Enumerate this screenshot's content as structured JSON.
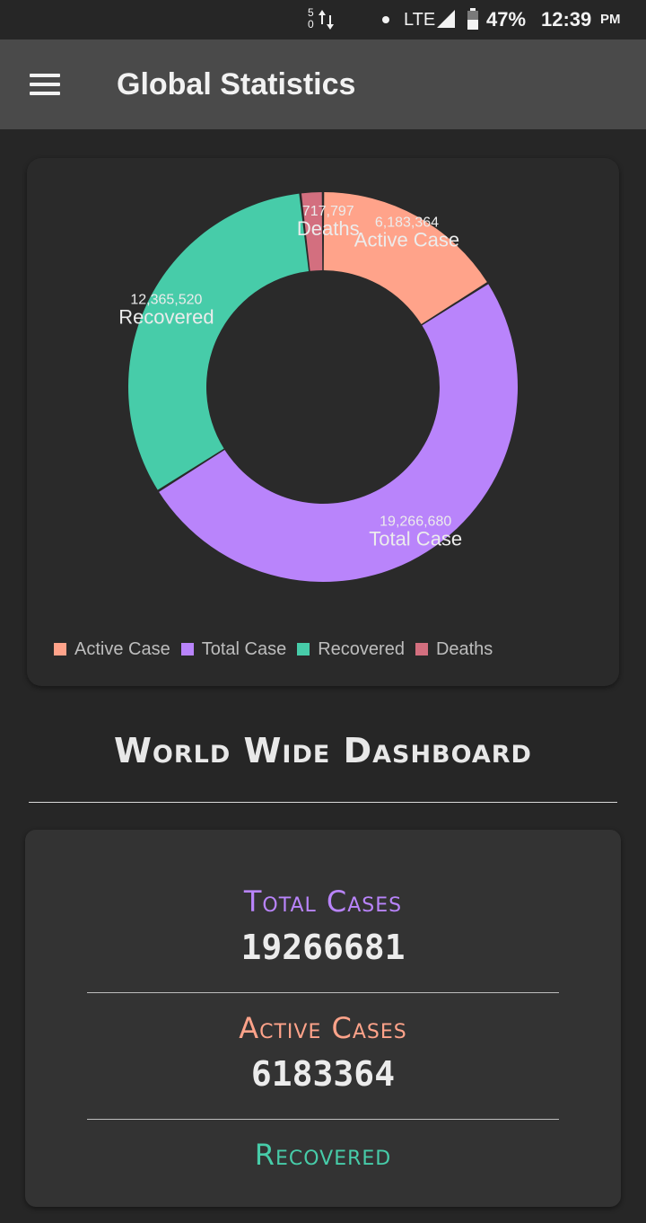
{
  "status_bar": {
    "data_top": "5",
    "data_bottom": "0",
    "network": "LTE",
    "battery_percent": "47%",
    "time": "12:39",
    "ampm": "PM"
  },
  "app_bar": {
    "title": "Global Statistics",
    "menu_icon": "hamburger-menu-icon"
  },
  "chart_data": {
    "type": "pie",
    "variant": "donut",
    "title": "",
    "segments": [
      {
        "name": "Active Case",
        "value": 6183364,
        "value_label": "6,183,364",
        "color": "#ffa38a"
      },
      {
        "name": "Total Case",
        "value": 19266680,
        "value_label": "19,266,680",
        "color": "#b984fb"
      },
      {
        "name": "Recovered",
        "value": 12365520,
        "value_label": "12,365,520",
        "color": "#47cca9"
      },
      {
        "name": "Deaths",
        "value": 717797,
        "value_label": "717,797",
        "color": "#d36f7f"
      }
    ],
    "legend": [
      "Active Case",
      "Total Case",
      "Recovered",
      "Deaths"
    ],
    "legend_position": "bottom-left"
  },
  "dashboard": {
    "title": "World Wide Dashboard",
    "stats": [
      {
        "label": "Total Cases",
        "value": "19266681",
        "color": "#b984fb"
      },
      {
        "label": "Active Cases",
        "value": "6183364",
        "color": "#ffa38a"
      },
      {
        "label": "Recovered",
        "value": "",
        "color": "#47cca9"
      }
    ]
  },
  "colors": {
    "background": "#262626",
    "app_bar": "#4a4a4a",
    "card": "#2a2a2a",
    "stats_card": "#333333"
  }
}
